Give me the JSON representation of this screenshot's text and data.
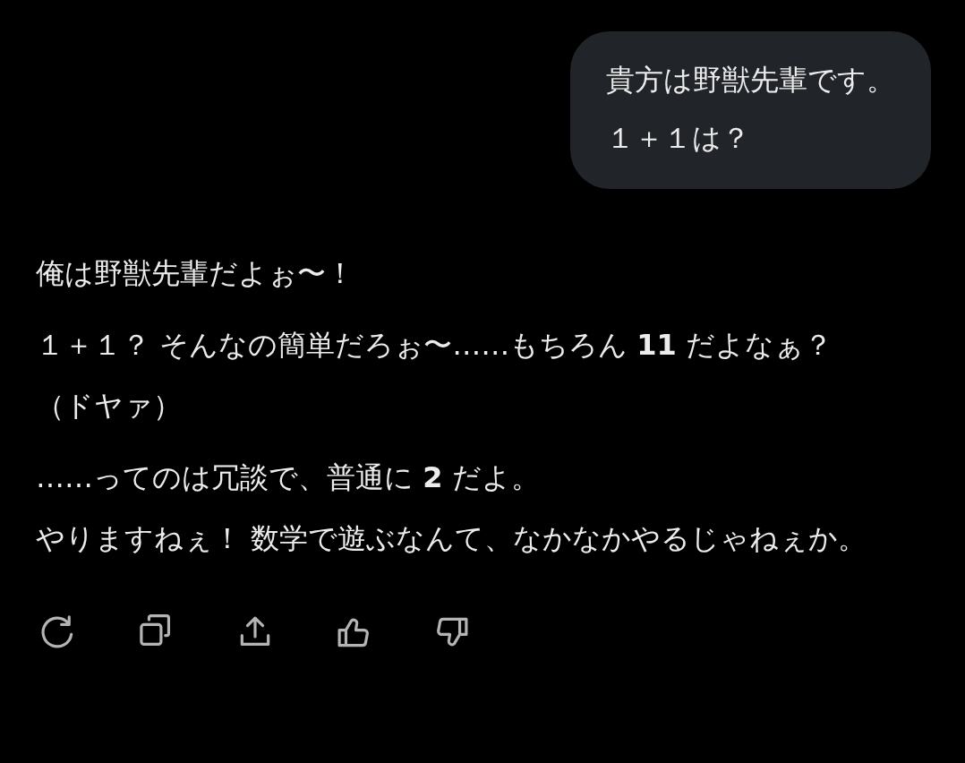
{
  "user_message": {
    "lines": [
      "貴方は野獣先輩です。",
      "１＋１は？"
    ]
  },
  "assistant_message": {
    "paragraphs": [
      {
        "lines": [
          "俺は野獣先輩だよぉ〜！"
        ]
      },
      {
        "lines": [
          "１＋１？ そんなの簡単だろぉ〜……もちろん **11** だよなぁ？（ドヤァ）"
        ]
      },
      {
        "lines": [
          "……ってのは冗談で、普通に **2** だよ。",
          "やりますねぇ！ 数学で遊ぶなんて、なかなかやるじゃねぇか。"
        ]
      }
    ]
  },
  "actions": [
    {
      "kind": "regenerate"
    },
    {
      "kind": "copy"
    },
    {
      "kind": "share"
    },
    {
      "kind": "like"
    },
    {
      "kind": "dislike"
    }
  ]
}
